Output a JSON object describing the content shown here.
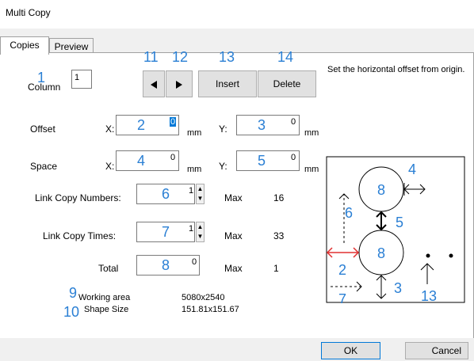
{
  "window": {
    "title": "Multi Copy"
  },
  "tabs": [
    {
      "label": "Copies"
    },
    {
      "label": "Preview"
    }
  ],
  "column": {
    "label": "Column",
    "value": "1",
    "annotation": "1"
  },
  "nav": {
    "prev_annotation": "11",
    "next_annotation": "12",
    "insert_label": "Insert",
    "insert_annotation": "13",
    "delete_label": "Delete",
    "delete_annotation": "14"
  },
  "help_text": "Set the horizontal offset from origin.",
  "offset": {
    "label": "Offset",
    "x_label": "X:",
    "x_value": "0",
    "x_annotation": "2",
    "y_label": "Y:",
    "y_value": "0",
    "y_annotation": "3",
    "unit": "mm"
  },
  "space": {
    "label": "Space",
    "x_label": "X:",
    "x_value": "0",
    "x_annotation": "4",
    "y_label": "Y:",
    "y_value": "0",
    "y_annotation": "5",
    "unit": "mm"
  },
  "link_copy_numbers": {
    "label": "Link Copy Numbers:",
    "value": "1",
    "annotation": "6",
    "max_label": "Max",
    "max_value": "16"
  },
  "link_copy_times": {
    "label": "Link Copy Times:",
    "value": "1",
    "annotation": "7",
    "max_label": "Max",
    "max_value": "33"
  },
  "total": {
    "label": "Total",
    "value": "0",
    "annotation": "8",
    "max_label": "Max",
    "max_value": "1"
  },
  "info": {
    "working_area_annotation": "9",
    "working_area_label": "Working area",
    "working_area_value": "5080x2540",
    "shape_size_annotation": "10",
    "shape_size_label": "Shape Size",
    "shape_size_value": "151.81x151.67"
  },
  "diagram": {
    "labels": [
      "8",
      "8",
      "4",
      "5",
      "6",
      "2",
      "3",
      "7",
      "13"
    ],
    "colors": {
      "annotation": "#2a7fd4",
      "offset_arrow": "#e03030",
      "line": "#000000"
    }
  },
  "buttons": {
    "ok_label": "OK",
    "cancel_label": "Cancel"
  },
  "colors": {
    "annotation": "#2a7fd4",
    "focus": "#0078d7"
  }
}
